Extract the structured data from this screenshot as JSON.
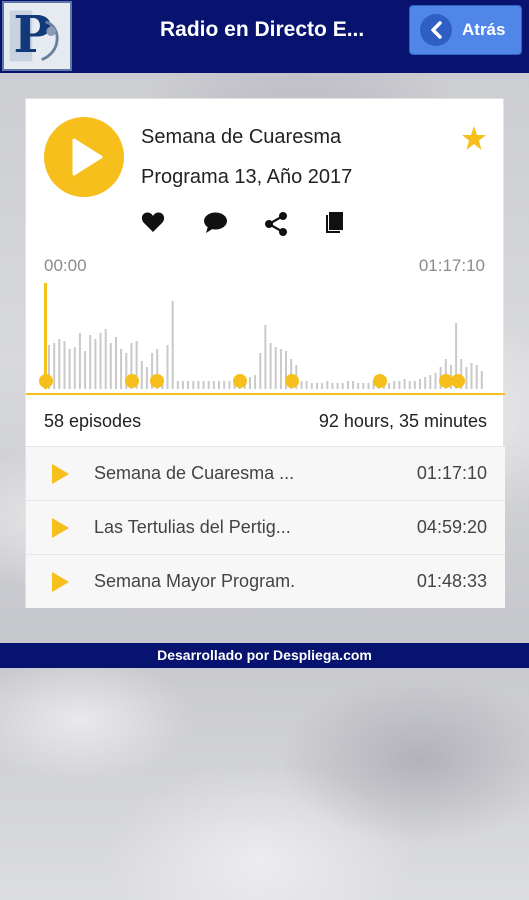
{
  "header": {
    "title": "Radio en Directo E...",
    "back_label": "Atrás",
    "logo_icon": "p-letter-logo",
    "colors": {
      "bar": "#07136e",
      "back_button": "#4f86e8"
    }
  },
  "player": {
    "title": "Semana de Cuaresma",
    "subtitle": "Programa 13, Año 2017",
    "current_time": "00:00",
    "total_time": "01:17:10",
    "accent": "#f6bf1c",
    "actions": [
      "heart-icon",
      "comment-icon",
      "share-icon",
      "book-icon"
    ]
  },
  "stats": {
    "episodes": "58 episodes",
    "duration": "92 hours, 35 minutes"
  },
  "episodes": [
    {
      "name": "Semana de Cuaresma ...",
      "duration": "01:17:10"
    },
    {
      "name": "Las Tertulias del Pertig...",
      "duration": "04:59:20"
    },
    {
      "name": "Semana Mayor Program.",
      "duration": "01:48:33"
    }
  ],
  "footer": {
    "text": "Desarrollado por Despliega.com"
  }
}
